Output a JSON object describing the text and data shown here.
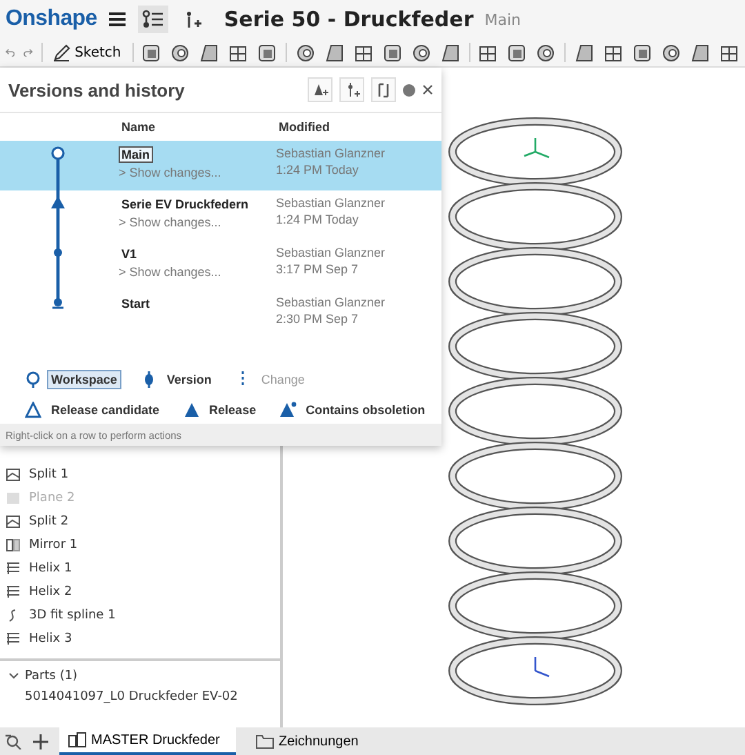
{
  "header": {
    "logo": "Onshape",
    "title": "Serie 50 - Druckfeder",
    "branch": "Main"
  },
  "toolbar": {
    "sketch_label": "Sketch"
  },
  "versions_panel": {
    "title": "Versions and history",
    "columns": [
      "Name",
      "Modified"
    ],
    "rows": [
      {
        "name": "Main",
        "show_changes": "> Show changes...",
        "author": "Sebastian Glanzner",
        "date": "1:24 PM Today",
        "kind": "workspace",
        "selected": true
      },
      {
        "name": "Serie EV Druckfedern",
        "show_changes": "> Show changes...",
        "author": "Sebastian Glanzner",
        "date": "1:24 PM Today",
        "kind": "release",
        "selected": false
      },
      {
        "name": "V1",
        "show_changes": "> Show changes...",
        "author": "Sebastian Glanzner",
        "date": "3:17 PM Sep 7",
        "kind": "version",
        "selected": false
      },
      {
        "name": "Start",
        "author": "Sebastian Glanzner",
        "date": "2:30 PM Sep 7",
        "kind": "start",
        "selected": false
      }
    ],
    "legend": [
      {
        "label": "Workspace",
        "kind": "workspace",
        "selected": true
      },
      {
        "label": "Version",
        "kind": "version",
        "selected": false
      },
      {
        "label": "Change",
        "kind": "change",
        "selected": false
      },
      {
        "label": "Release candidate",
        "kind": "candidate",
        "selected": false
      },
      {
        "label": "Release",
        "kind": "release",
        "selected": false
      },
      {
        "label": "Contains obsoletion",
        "kind": "obsolete",
        "selected": false
      }
    ],
    "footer": "Right-click on a row to perform actions"
  },
  "feature_tree": {
    "items": [
      {
        "label": "Split 1",
        "kind": "split",
        "disabled": false
      },
      {
        "label": "Plane 2",
        "kind": "plane",
        "disabled": true
      },
      {
        "label": "Split 2",
        "kind": "split",
        "disabled": false
      },
      {
        "label": "Mirror 1",
        "kind": "mirror",
        "disabled": false
      },
      {
        "label": "Helix 1",
        "kind": "helix",
        "disabled": false
      },
      {
        "label": "Helix 2",
        "kind": "helix",
        "disabled": false
      },
      {
        "label": "3D fit spline 1",
        "kind": "spline",
        "disabled": false
      },
      {
        "label": "Helix 3",
        "kind": "helix",
        "disabled": false
      }
    ],
    "parts": {
      "title": "Parts (1)",
      "expanded": true,
      "items": [
        "5014041097_L0 Druckfeder EV-02"
      ]
    }
  },
  "tabs": [
    {
      "label": "MASTER Druckfeder",
      "kind": "partstudio",
      "selected": true
    },
    {
      "label": "Zeichnungen",
      "kind": "folder",
      "selected": false
    }
  ]
}
